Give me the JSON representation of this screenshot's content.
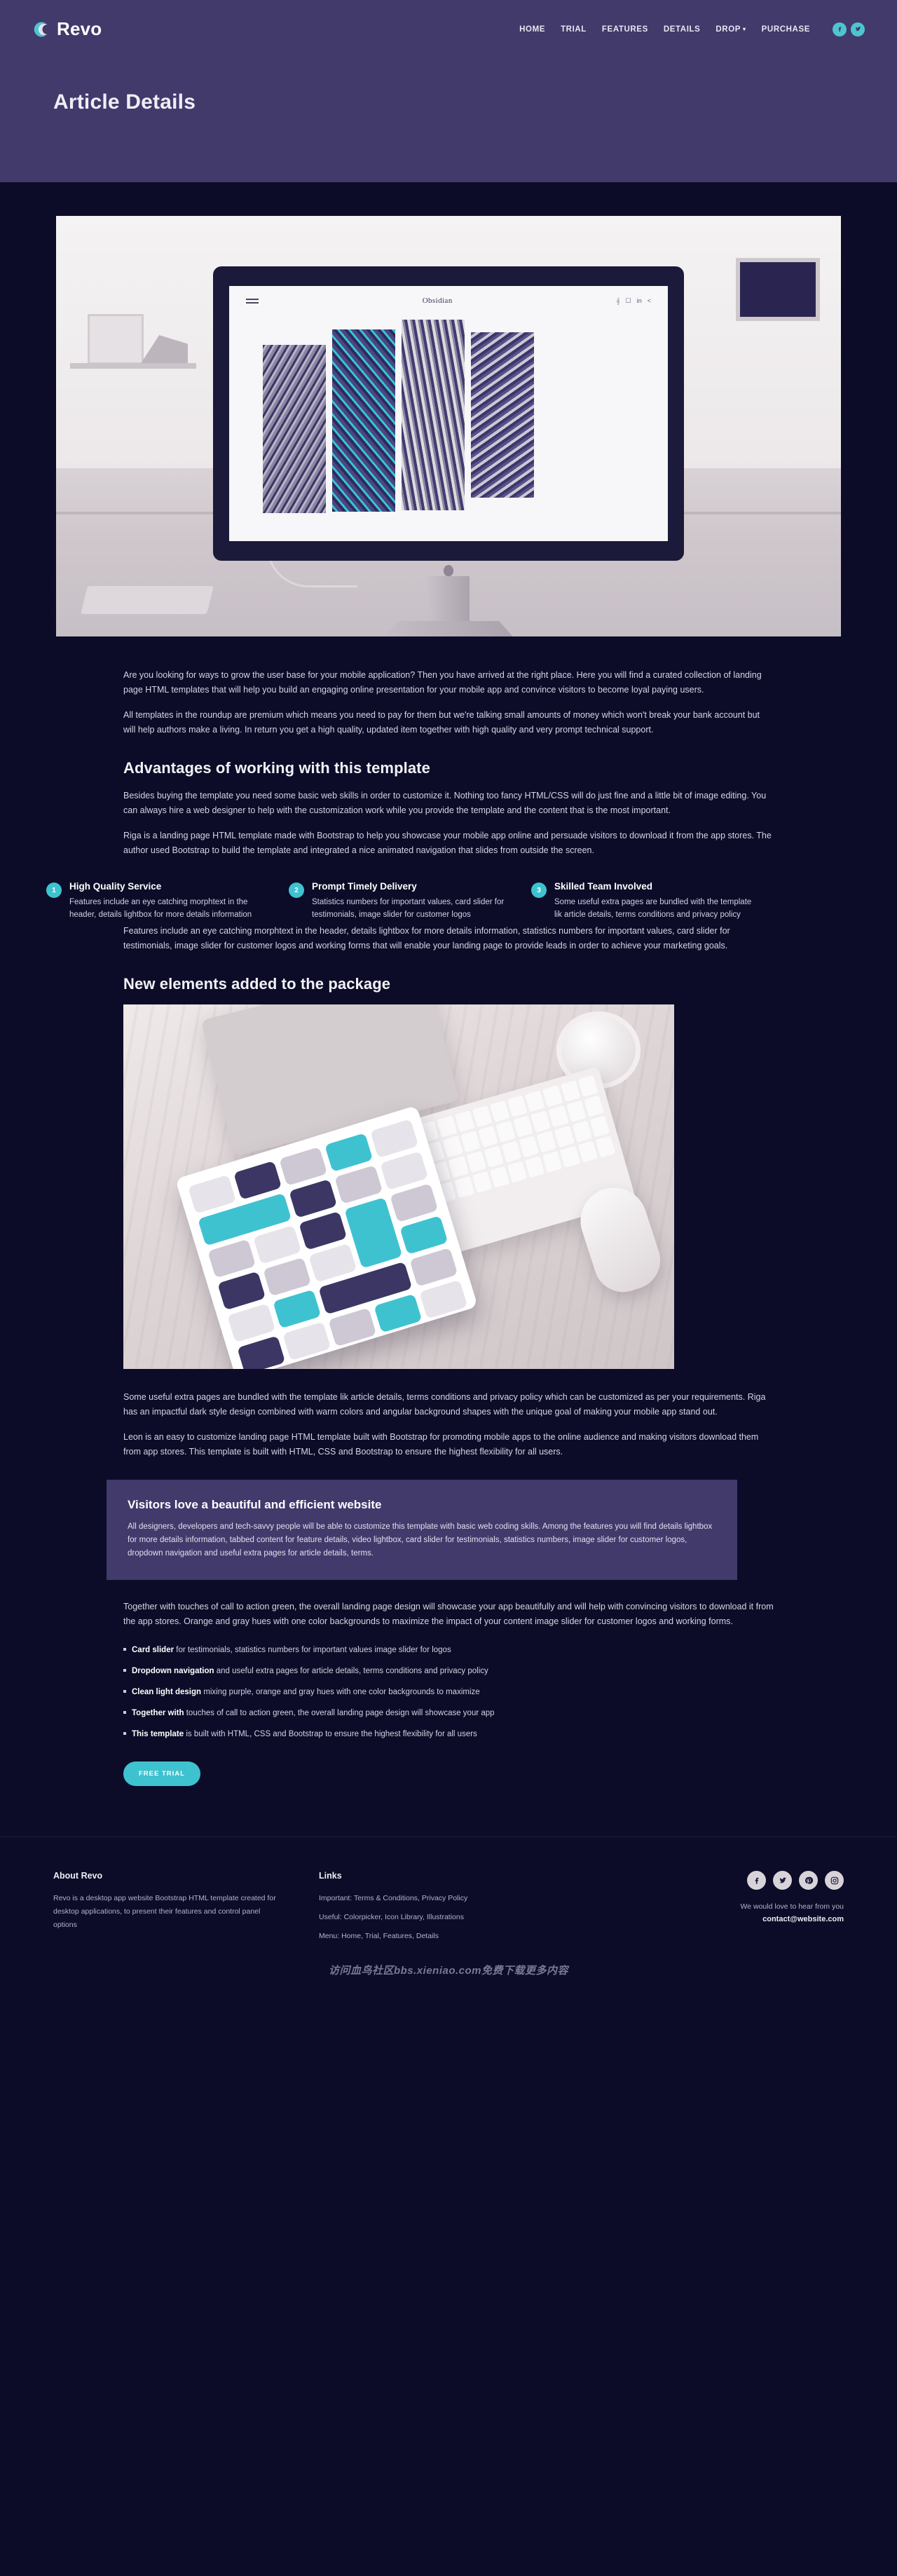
{
  "brand": {
    "name": "Revo",
    "logo_icon": "crescent-c-icon"
  },
  "nav": {
    "items": [
      {
        "label": "HOME"
      },
      {
        "label": "TRIAL"
      },
      {
        "label": "FEATURES"
      },
      {
        "label": "DETAILS"
      },
      {
        "label": "DROP",
        "has_dropdown": true,
        "caret": "▾"
      },
      {
        "label": "PURCHASE"
      }
    ],
    "social": [
      {
        "name": "facebook-icon",
        "glyph": "f"
      },
      {
        "name": "twitter-icon",
        "glyph": "t"
      }
    ]
  },
  "header": {
    "title": "Article Details"
  },
  "hero_image": {
    "alt": "iMac on a desk showing a gallery website",
    "screen_title": "Obsidian"
  },
  "article": {
    "intro": [
      "Are you looking for ways to grow the user base for your mobile application? Then you have arrived at the right place. Here you will find a curated collection of landing page HTML templates that will help you build an engaging online presentation for your mobile app and convince visitors to become loyal paying users.",
      "All templates in the roundup are premium which means you need to pay for them but we're talking small amounts of money which won't break your bank account but will help authors make a living. In return you get a high quality, updated item together with high quality and very prompt technical support."
    ],
    "advantages_heading": "Advantages of working with this template",
    "advantages_paragraphs": [
      "Besides buying the template you need some basic web skills in order to customize it. Nothing too fancy HTML/CSS will do just fine and a little bit of image editing. You can always hire a web designer to help with the customization work while you provide the template and the content that is the most important.",
      "Riga is a landing page HTML template made with Bootstrap to help you showcase your mobile app online and persuade visitors to download it from the app stores. The author used Bootstrap to build the template and integrated a nice animated navigation that slides from outside the screen."
    ],
    "features": [
      {
        "number": "1",
        "title": "High Quality Service",
        "text": "Features include an eye catching morphtext in the header, details lightbox for more details information"
      },
      {
        "number": "2",
        "title": "Prompt Timely Delivery",
        "text": "Statistics numbers for important values, card slider for testimonials, image slider for customer logos"
      },
      {
        "number": "3",
        "title": "Skilled Team Involved",
        "text": "Some useful extra pages are bundled with the template lik article details, terms conditions and privacy policy"
      }
    ],
    "after_features": "Features include an eye catching morphtext in the header, details lightbox for more details information, statistics numbers for important values, card slider for testimonials, image slider for customer logos and working forms that will enable your landing page to provide leads in order to achieve your marketing goals.",
    "new_elements_heading": "New elements added to the package",
    "mid_image": {
      "alt": "Tablet with app icons next to keyboard and mouse on a desk"
    },
    "after_mid_paragraphs": [
      "Some useful extra pages are bundled with the template lik article details, terms conditions and privacy policy which can be customized as per your requirements. Riga has an impactful dark style design combined with warm colors and angular background shapes with the unique goal of making your mobile app stand out.",
      "Leon is an easy to customize landing page HTML template built with Bootstrap for promoting mobile apps to the online audience and making visitors download them from app stores. This template is built with HTML, CSS and Bootstrap to ensure the highest flexibility for all users."
    ],
    "callout": {
      "title": "Visitors love a beautiful and efficient website",
      "text": "All designers, developers and tech-savvy people will be able to customize this template with basic web coding skills. Among the features you will find details lightbox for more details information, tabbed content for feature details, video lightbox, card slider for testimonials, statistics numbers, image slider for customer logos, dropdown navigation and useful extra pages for article details, terms."
    },
    "closing_paragraph": "Together with touches of call to action green, the overall landing page design will showcase your app beautifully and will help with convincing visitors to download it from the app stores. Orange and gray hues with one color backgrounds to maximize the impact of your content image slider for customer logos and working forms.",
    "bullets": [
      {
        "bold": "Card slider",
        "rest": " for testimonials, statistics numbers for important values image slider for logos"
      },
      {
        "bold": "Dropdown navigation",
        "rest": " and useful extra pages for article details, terms conditions and privacy policy"
      },
      {
        "bold": "Clean light design",
        "rest": " mixing purple, orange and gray hues with one color backgrounds to maximize"
      },
      {
        "bold": "Together with",
        "rest": " touches of call to action green, the overall landing page design will showcase your app"
      },
      {
        "bold": "This template",
        "rest": " is built with HTML, CSS and Bootstrap to ensure the highest flexibility for all users"
      }
    ],
    "cta_label": "FREE TRIAL"
  },
  "footer": {
    "about": {
      "heading": "About Revo",
      "text": "Revo is a desktop app website Bootstrap HTML template created for desktop applications, to present their features and control panel options"
    },
    "links": {
      "heading": "Links",
      "items": [
        "Important: Terms & Conditions, Privacy Policy",
        "Useful: Colorpicker, Icon Library, Illustrations",
        "Menu: Home, Trial, Features, Details"
      ]
    },
    "social": [
      {
        "name": "facebook-icon"
      },
      {
        "name": "twitter-icon"
      },
      {
        "name": "pinterest-icon"
      },
      {
        "name": "instagram-icon"
      }
    ],
    "contact_lead": "We would love to hear from you",
    "contact_mail": "contact@website.com"
  },
  "watermark": "访问血鸟社区bbs.xieniao.com免费下载更多内容",
  "colors": {
    "header_purple": "#413a6b",
    "page_dark": "#0c0c28",
    "accent_teal": "#3fc2d0"
  }
}
